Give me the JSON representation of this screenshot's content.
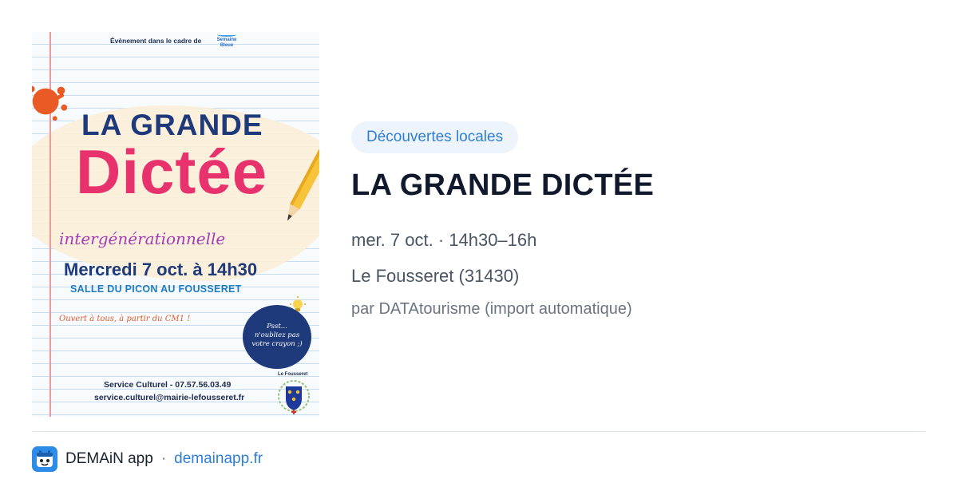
{
  "poster": {
    "header_text": "Évènement dans le cadre de",
    "partner_logo_text": "Semaine Bleue",
    "title_top": "LA GRANDE",
    "title_main": "Dictée",
    "subtitle": "intergénérationnelle",
    "date_time": "Mercredi 7 oct. à 14h30",
    "venue": "SALLE DU PICON AU FOUSSERET",
    "audience": "Ouvert à tous, à partir du CM1 !",
    "reminder": [
      "Psst...",
      "n'oubliez pas",
      "votre crayon ;)"
    ],
    "contact_phone": "Service Culturel - 07.57.56.03.49",
    "contact_email": "service.culturel@mairie-lefousseret.fr",
    "town_label": "Le Fousseret",
    "colors": {
      "title_blue": "#1f3a7a",
      "title_pink": "#e8326e",
      "accent_purple": "#a43cb5"
    }
  },
  "event": {
    "category": "Découvertes locales",
    "title": "LA GRANDE DICTÉE",
    "datetime": "mer. 7 oct. · 14h30–16h",
    "location": "Le Fousseret (31430)",
    "source": "par DATAtourisme (import automatique)"
  },
  "footer": {
    "app_name": "DEMAiN app",
    "separator": "·",
    "site": "demainapp.fr",
    "icon": "demain-app-icon"
  },
  "colors": {
    "accent": "#2f7ed3",
    "pill_bg": "#eef4fb",
    "divider": "#dfe5ec"
  }
}
